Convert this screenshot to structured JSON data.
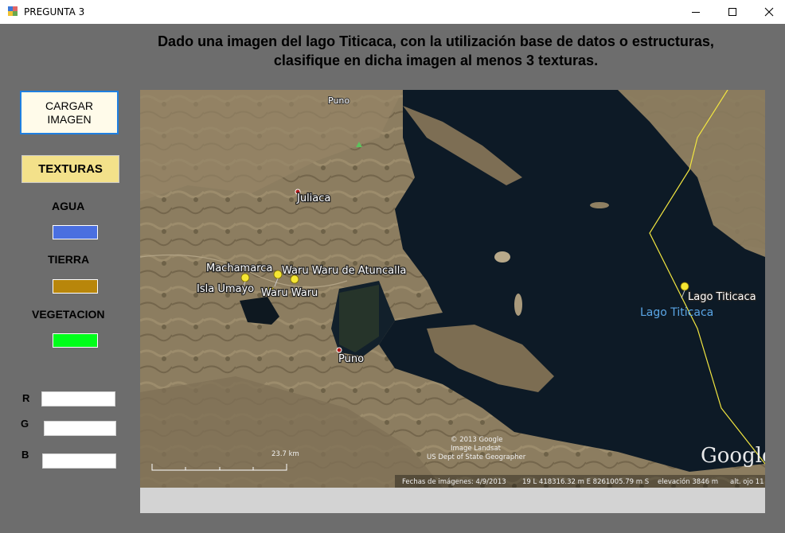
{
  "window": {
    "title": "PREGUNTA 3",
    "minimize_icon": "minimize-icon",
    "maximize_icon": "maximize-icon",
    "close_icon": "close-icon"
  },
  "heading": {
    "line1": "Dado una imagen del lago Titicaca, con la utilización base de datos o estructuras,",
    "line2": "clasifique en dicha imagen al menos 3 texturas."
  },
  "buttons": {
    "cargar_line1": "CARGAR",
    "cargar_line2": "IMAGEN",
    "texturas": "TEXTURAS"
  },
  "textures": [
    {
      "label": "AGUA",
      "color": "#4a6fe0"
    },
    {
      "label": "TIERRA",
      "color": "#b8860b"
    },
    {
      "label": "VEGETACION",
      "color": "#00ff1a"
    }
  ],
  "rgb": {
    "r_label": "R",
    "r_value": "",
    "g_label": "G",
    "g_value": "",
    "b_label": "B",
    "b_value": ""
  },
  "map": {
    "labels": {
      "puno_top": "Puno",
      "juliaca": "Juliaca",
      "machamarca": "Machamarca",
      "waru_atuncalla": "Waru Waru de Atuncalla",
      "isla_umayo": "Isla Umayo",
      "waru_waru": "Waru Waru",
      "puno": "Puno",
      "lago_titicaca_pin": "Lago Titicaca",
      "lago_titicaca": "Lago Titicaca"
    },
    "scale": "23.7 km",
    "copyright1": "© 2013 Google",
    "copyright2": "Image Landsat",
    "copyright3": "US Dept of State Geographer",
    "status_date": "Fechas de imágenes: 4/9/2013",
    "status_coords": "19 L 418316.32 m E 8261005.79 m S",
    "status_elev": "elevación  3846 m",
    "status_alt": "alt. ojo 11",
    "brand": "Google"
  }
}
